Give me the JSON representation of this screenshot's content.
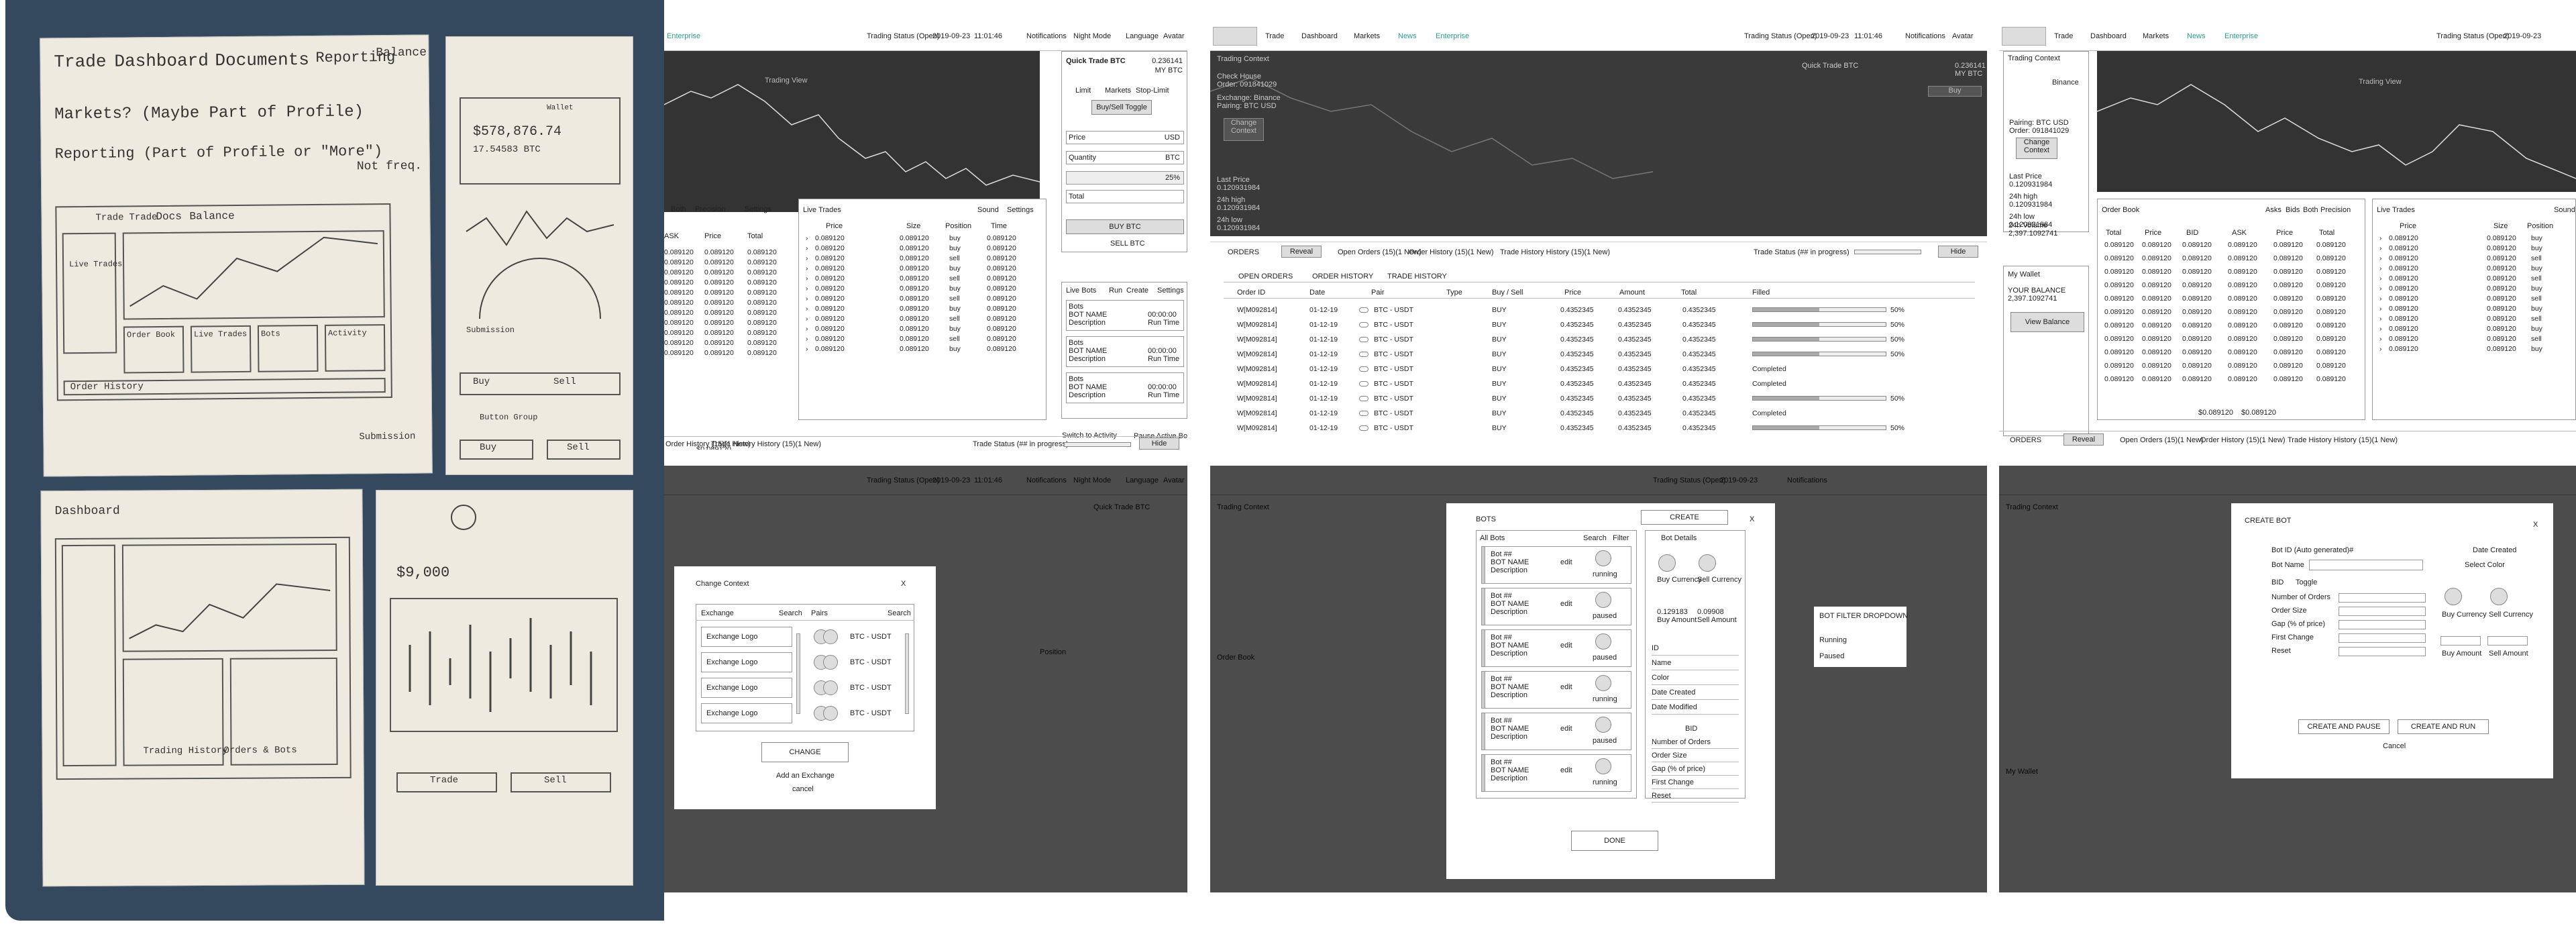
{
  "sketches": {
    "page1": [
      "Trade",
      "Dashboard",
      "Documents",
      "Reporting",
      "Balance",
      "Markets? (Maybe Part of Profile)",
      "Reporting (Part of Profile or \"More\")",
      "Not freq. used",
      "Trade",
      "Trade",
      "Docs",
      "Balance",
      "Live Trades",
      "Order Book",
      "Live Trades",
      "Bots",
      "Activity",
      "Order History",
      "Submission"
    ],
    "page2": [
      "$578,876.74",
      "17.54583 BTC",
      "Submission",
      "Wallet",
      "Buy",
      "Sell",
      "Button Group",
      "Buy",
      "Sell"
    ],
    "page3": [
      "Dashboard",
      "Trading History",
      "Orders & Bots"
    ],
    "page4": [
      "$9,000",
      "Trade",
      "Sell"
    ]
  },
  "app": {
    "status": "Trading Status (Open)",
    "date": "2019-09-23",
    "time": "11:01:46",
    "notifications": "Notifications",
    "night": "Night Mode",
    "language": "Language",
    "avatar": "Avatar",
    "nav": [
      "Trade",
      "Dashboard",
      "Markets",
      "News",
      "Enterprise"
    ],
    "enterprise": "Enterprise"
  },
  "labels": {
    "trading_view": "Trading View",
    "quick_trade": "Quick Trade BTC",
    "qt_amount": "0.236141",
    "qt_unit": "MY BTC",
    "limit": "Limit",
    "market": "Market",
    "markets": "Markets",
    "stop_limit": "Stop-Limit",
    "buysell_toggle": "Buy/Sell Toggle",
    "price": "Price",
    "usd": "USD",
    "quantity": "Quantity",
    "btc": "BTC",
    "pct": "25%",
    "total": "Total",
    "buy_btc": "BUY BTC",
    "sell_btc": "SELL BTC",
    "order_book": "Order Book",
    "asks": "Asks",
    "both": "Both",
    "bids": "Bids",
    "precision": "Precision",
    "settings": "Settings",
    "sound": "Sound",
    "ask": "ASK",
    "bid": "BID",
    "size": "Size",
    "position": "Position",
    "time": "Time",
    "live_trades": "Live Trades",
    "live_bots": "Live Bots",
    "run": "Run",
    "create": "Create",
    "bots": "Bots",
    "bot_name": "BOT NAME",
    "description": "Description",
    "run_time": "Run Time",
    "run_val": "00:00:00",
    "switch": "Switch to Activity",
    "pause_active": "Pause Active Bots",
    "mid": "$0.089120",
    "mid_plain": "0.089120",
    "trade_status_bar": "Trade Status (## in progress)",
    "hide": "Hide",
    "reveal": "Reveal",
    "orders": "ORDERS",
    "open_orders": "Open Orders (15)(1 New)",
    "order_history": "Order History (15)(1 New)",
    "trade_history": "Trade History History (15)(1 New)",
    "open_orders_tab": "OPEN ORDERS",
    "order_history_tab": "ORDER HISTORY",
    "trade_history_tab": "TRADE HISTORY",
    "order_id": "Order ID",
    "date": "Date",
    "pair": "Pair",
    "type": "Type",
    "buysell": "Buy / Sell",
    "amount": "Amount",
    "total_col": "Total",
    "filled": "Filled",
    "trading_context": "Trading Context",
    "binance": "Binance",
    "check_house": "Check House",
    "ref_id": "Order: 091841029",
    "exchange_binance": "Exchange: Binance",
    "pairing_btc": "Pairing: BTC USD",
    "change_context": "Change Context",
    "pairing": "Pairing: BTC USD",
    "order": "Order: 091841029",
    "last_price": "Last Price",
    "last_price_val": "0.120931984",
    "h24": "24h high",
    "h24_val": "0.120931984",
    "l24": "24h low",
    "l24_val": "0.120931984",
    "v24": "24h Volume",
    "v24_val": "2,397.1092741",
    "my_wallet": "My Wallet",
    "your_balance": "YOUR BALANCE",
    "bal_val": "2,397.1092741",
    "view_balance": "View Balance"
  },
  "orderbook_vals": [
    "0.089120",
    "0.089120",
    "0.089120",
    "0.089120",
    "0.089120",
    "0.089120",
    "0.089120",
    "0.089120",
    "0.089120",
    "0.089120",
    "0.089120"
  ],
  "trades": [
    [
      "0.089120",
      "0.089120",
      "buy",
      "0.089120"
    ],
    [
      "0.089120",
      "0.089120",
      "buy",
      "0.089120"
    ],
    [
      "0.089120",
      "0.089120",
      "sell",
      "0.089120"
    ],
    [
      "0.089120",
      "0.089120",
      "buy",
      "0.089120"
    ],
    [
      "0.089120",
      "0.089120",
      "sell",
      "0.089120"
    ],
    [
      "0.089120",
      "0.089120",
      "buy",
      "0.089120"
    ],
    [
      "0.089120",
      "0.089120",
      "sell",
      "0.089120"
    ],
    [
      "0.089120",
      "0.089120",
      "buy",
      "0.089120"
    ],
    [
      "0.089120",
      "0.089120",
      "sell",
      "0.089120"
    ],
    [
      "0.089120",
      "0.089120",
      "buy",
      "0.089120"
    ],
    [
      "0.089120",
      "0.089120",
      "sell",
      "0.089120"
    ],
    [
      "0.089120",
      "0.089120",
      "buy",
      "0.089120"
    ]
  ],
  "orders": [
    {
      "id": "W[M092814]",
      "date": "01-12-19",
      "pair": "BTC - USDT",
      "side": "BUY",
      "price": "0.4352345",
      "amount": "0.4352345",
      "total": "0.4352345",
      "status": "",
      "filled": 0.5,
      "pct": "50%"
    },
    {
      "id": "W[M092814]",
      "date": "01-12-19",
      "pair": "BTC - USDT",
      "side": "BUY",
      "price": "0.4352345",
      "amount": "0.4352345",
      "total": "0.4352345",
      "status": "",
      "filled": 0.5,
      "pct": "50%"
    },
    {
      "id": "W[M092814]",
      "date": "01-12-19",
      "pair": "BTC - USDT",
      "side": "BUY",
      "price": "0.4352345",
      "amount": "0.4352345",
      "total": "0.4352345",
      "status": "",
      "filled": 0.5,
      "pct": "50%"
    },
    {
      "id": "W[M092814]",
      "date": "01-12-19",
      "pair": "BTC - USDT",
      "side": "BUY",
      "price": "0.4352345",
      "amount": "0.4352345",
      "total": "0.4352345",
      "status": "",
      "filled": 0.5,
      "pct": "50%"
    },
    {
      "id": "W[M092814]",
      "date": "01-12-19",
      "pair": "BTC - USDT",
      "side": "BUY",
      "price": "0.4352345",
      "amount": "0.4352345",
      "total": "0.4352345",
      "status": "Completed",
      "filled": 0,
      "pct": ""
    },
    {
      "id": "W[M092814]",
      "date": "01-12-19",
      "pair": "BTC - USDT",
      "side": "BUY",
      "price": "0.4352345",
      "amount": "0.4352345",
      "total": "0.4352345",
      "status": "Completed",
      "filled": 0,
      "pct": ""
    },
    {
      "id": "W[M092814]",
      "date": "01-12-19",
      "pair": "BTC - USDT",
      "side": "BUY",
      "price": "0.4352345",
      "amount": "0.4352345",
      "total": "0.4352345",
      "status": "",
      "filled": 0.5,
      "pct": "50%"
    },
    {
      "id": "W[M092814]",
      "date": "01-12-19",
      "pair": "BTC - USDT",
      "side": "BUY",
      "price": "0.4352345",
      "amount": "0.4352345",
      "total": "0.4352345",
      "status": "Completed",
      "filled": 0,
      "pct": ""
    },
    {
      "id": "W[M092814]",
      "date": "01-12-19",
      "pair": "BTC - USDT",
      "side": "BUY",
      "price": "0.4352345",
      "amount": "0.4352345",
      "total": "0.4352345",
      "status": "",
      "filled": 0.5,
      "pct": "50%"
    }
  ],
  "change_context": {
    "title": "Change Context",
    "close": "X",
    "exchange": "Exchange",
    "search": "Search",
    "pairs": "Pairs",
    "logos": [
      "Exchange Logo",
      "Exchange Logo",
      "Exchange Logo",
      "Exchange Logo"
    ],
    "pair_items": [
      "BTC - USDT",
      "BTC - USDT",
      "BTC - USDT",
      "BTC - USDT"
    ],
    "change": "CHANGE",
    "add": "Add an Exchange",
    "cancel": "cancel"
  },
  "bots_modal": {
    "title": "BOTS",
    "create": "CREATE",
    "close": "X",
    "all_bots": "All Bots",
    "search": "Search",
    "filter": "Filter",
    "items": [
      {
        "id": "Bot ##",
        "name": "BOT NAME",
        "desc": "Description",
        "edit": "edit",
        "state": "running"
      },
      {
        "id": "Bot ##",
        "name": "BOT NAME",
        "desc": "Description",
        "edit": "edit",
        "state": "paused"
      },
      {
        "id": "Bot ##",
        "name": "BOT NAME",
        "desc": "Description",
        "edit": "edit",
        "state": "paused"
      },
      {
        "id": "Bot ##",
        "name": "BOT NAME",
        "desc": "Description",
        "edit": "edit",
        "state": "running"
      },
      {
        "id": "Bot ##",
        "name": "BOT NAME",
        "desc": "Description",
        "edit": "edit",
        "state": "paused"
      },
      {
        "id": "Bot ##",
        "name": "BOT NAME",
        "desc": "Description",
        "edit": "edit",
        "state": "running"
      }
    ],
    "details": "Bot Details",
    "buy_currency": "Buy Currency",
    "sell_currency": "Sell Currency",
    "buy_val": "0.129183",
    "sell_val": "0.09908",
    "buy_amount": "Buy Amount",
    "sell_amount": "Sell Amount",
    "fields": [
      "ID",
      "Name",
      "Color",
      "Date Created",
      "Date Modified"
    ],
    "bid": "BID",
    "bid_fields": [
      "Number of Orders",
      "Order Size",
      "Gap (% of price)",
      "First Change",
      "Reset"
    ],
    "done": "DONE",
    "dropdown": {
      "title": "BOT FILTER DROPDOWN",
      "items": [
        "Running",
        "Paused"
      ]
    }
  },
  "create_bot": {
    "title": "CREATE BOT",
    "close": "X",
    "id_label": "Bot ID (Auto generated)#",
    "date_created": "Date Created",
    "bot_name": "Bot Name",
    "select_color": "Select Color",
    "bid": "BID",
    "toggle": "Toggle",
    "fields": [
      "Number of Orders",
      "Order Size",
      "Gap (% of price)",
      "First Change",
      "Reset"
    ],
    "buy_currency": "Buy Currency",
    "sell_currency": "Sell Currency",
    "buy_amount": "Buy Amount",
    "sell_amount": "Sell Amount",
    "create_pause": "CREATE AND PAUSE",
    "create_run": "CREATE AND RUN",
    "cancel": "Cancel"
  }
}
